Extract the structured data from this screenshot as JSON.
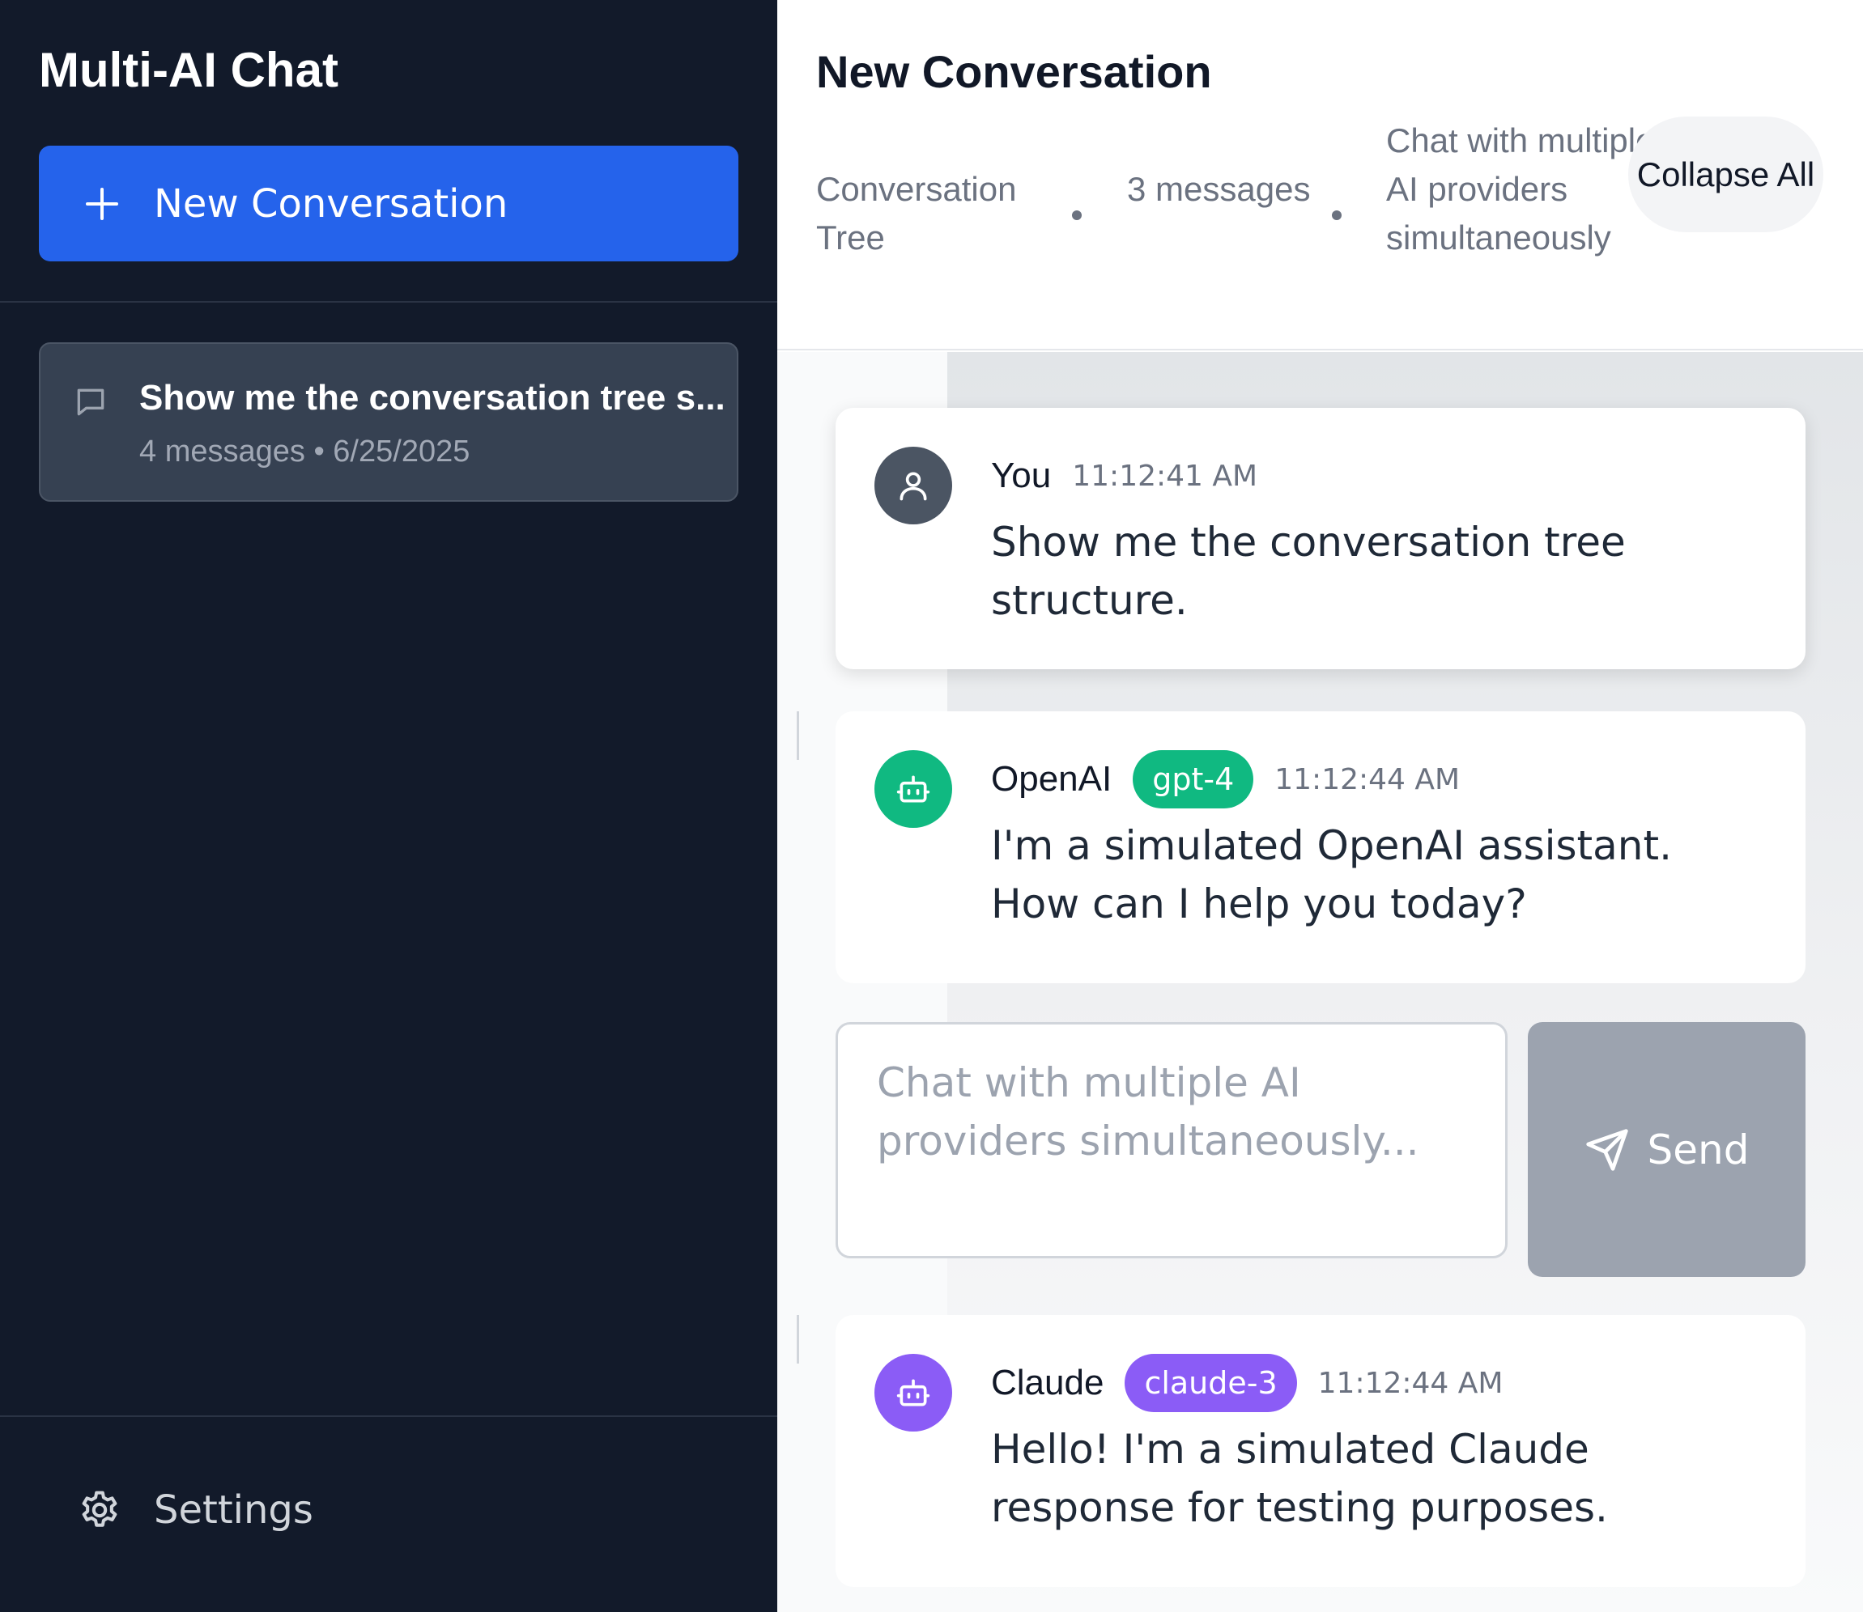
{
  "sidebar": {
    "app_title": "Multi-AI Chat",
    "new_conversation_label": "New Conversation",
    "conversations": [
      {
        "title": "Show me the conversation tree s...",
        "meta": "4 messages • 6/25/2025"
      }
    ],
    "settings_label": "Settings"
  },
  "header": {
    "title": "New Conversation",
    "view_label": "Conversation Tree",
    "message_count": "3 messages",
    "description": "Chat with multiple AI providers simultaneously",
    "collapse_label": "Collapse All"
  },
  "messages": [
    {
      "sender": "You",
      "time": "11:12:41 AM",
      "text": "Show me the conversation tree structure.",
      "avatar_icon": "user-icon",
      "avatar_color": "#4b5563"
    },
    {
      "sender": "OpenAI",
      "model": "gpt-4",
      "time": "11:12:44 AM",
      "text": "I'm a simulated OpenAI assistant. How can I help you today?",
      "avatar_icon": "bot-icon",
      "avatar_color": "#10b981"
    },
    {
      "sender": "Claude",
      "model": "claude-3",
      "time": "11:12:44 AM",
      "text": "Hello! I'm a simulated Claude response for testing purposes.",
      "avatar_icon": "bot-icon",
      "avatar_color": "#8b5cf6"
    }
  ],
  "composer": {
    "placeholder": "Chat with multiple AI providers simultaneously...",
    "value": "",
    "send_label": "Send"
  },
  "colors": {
    "sidebar_bg": "#121a2a",
    "accent": "#2563eb",
    "openai": "#10b981",
    "claude": "#8b5cf6",
    "send_disabled": "#9ca3af"
  }
}
